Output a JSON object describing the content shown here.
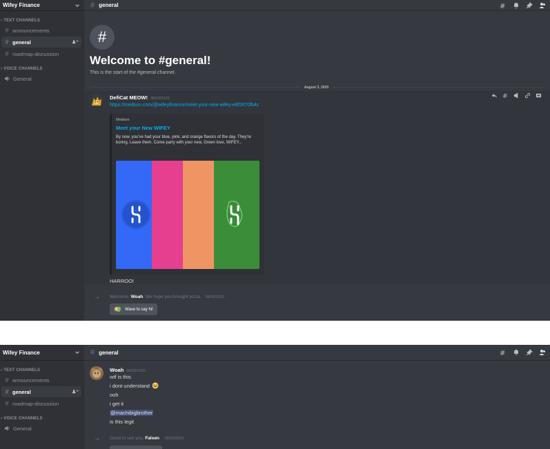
{
  "colors": {
    "background": "#36393f",
    "sidebar": "#2f3136",
    "link": "#00aff4",
    "green": "#43b581",
    "stripe_blue": "#3468f6",
    "stripe_pink": "#e63f8f",
    "stripe_orange": "#ef9563",
    "stripe_green": "#3c8d3a"
  },
  "top": {
    "server_name": "Wifey Finance",
    "categories": {
      "text": "TEXT CHANNELS",
      "voice": "VOICE CHANNELS"
    },
    "channels": [
      {
        "name": "announcements"
      },
      {
        "name": "general"
      },
      {
        "name": "roadmap-discussion"
      }
    ],
    "voice_channels": [
      {
        "name": "General"
      }
    ],
    "header": {
      "channel": "general"
    },
    "welcome": {
      "hash": "#",
      "title": "Welcome to #general!",
      "subtitle": "This is the start of the #general channel."
    },
    "date_divider": "August 3, 2020",
    "message": {
      "author": "DefiCat MEOW!",
      "timestamp": "08/03/2020",
      "link": "https://medium.com/@wifeyfinance/meet-your-new-wifey-e8f2670fb4c",
      "embed": {
        "provider": "Medium",
        "title": "Meet your New WIFEY",
        "description": "By now, you've had your blue, pink, and orange flavors of the day. They're boring. Leave them. Come party with your new, Green love, WIFEY..."
      },
      "followup": "HARROO!"
    },
    "system": {
      "prefix": "Welcome, ",
      "user": "Woah",
      "suffix": ". We hope you brought pizza.",
      "timestamp": "08/03/2020",
      "wave_label": "Wave to say hi!"
    }
  },
  "bottom": {
    "server_name": "Wifey Finance",
    "categories": {
      "text": "TEXT CHANNELS",
      "voice": "VOICE CHANNELS"
    },
    "channels": [
      {
        "name": "announcements"
      },
      {
        "name": "general"
      },
      {
        "name": "roadmap-discussion"
      }
    ],
    "voice_channels": [
      {
        "name": "General"
      }
    ],
    "header": {
      "channel": "general"
    },
    "message": {
      "author": "Woah",
      "timestamp": "08/03/2020",
      "lines": [
        "wtf is this",
        "i dont understand",
        "ooh",
        "i get it",
        "@machibigbrother",
        "is this legit"
      ]
    },
    "system": {
      "prefix": "Good to see you, ",
      "user": "Falsen",
      "suffix": ".",
      "timestamp": "08/03/2020"
    }
  }
}
